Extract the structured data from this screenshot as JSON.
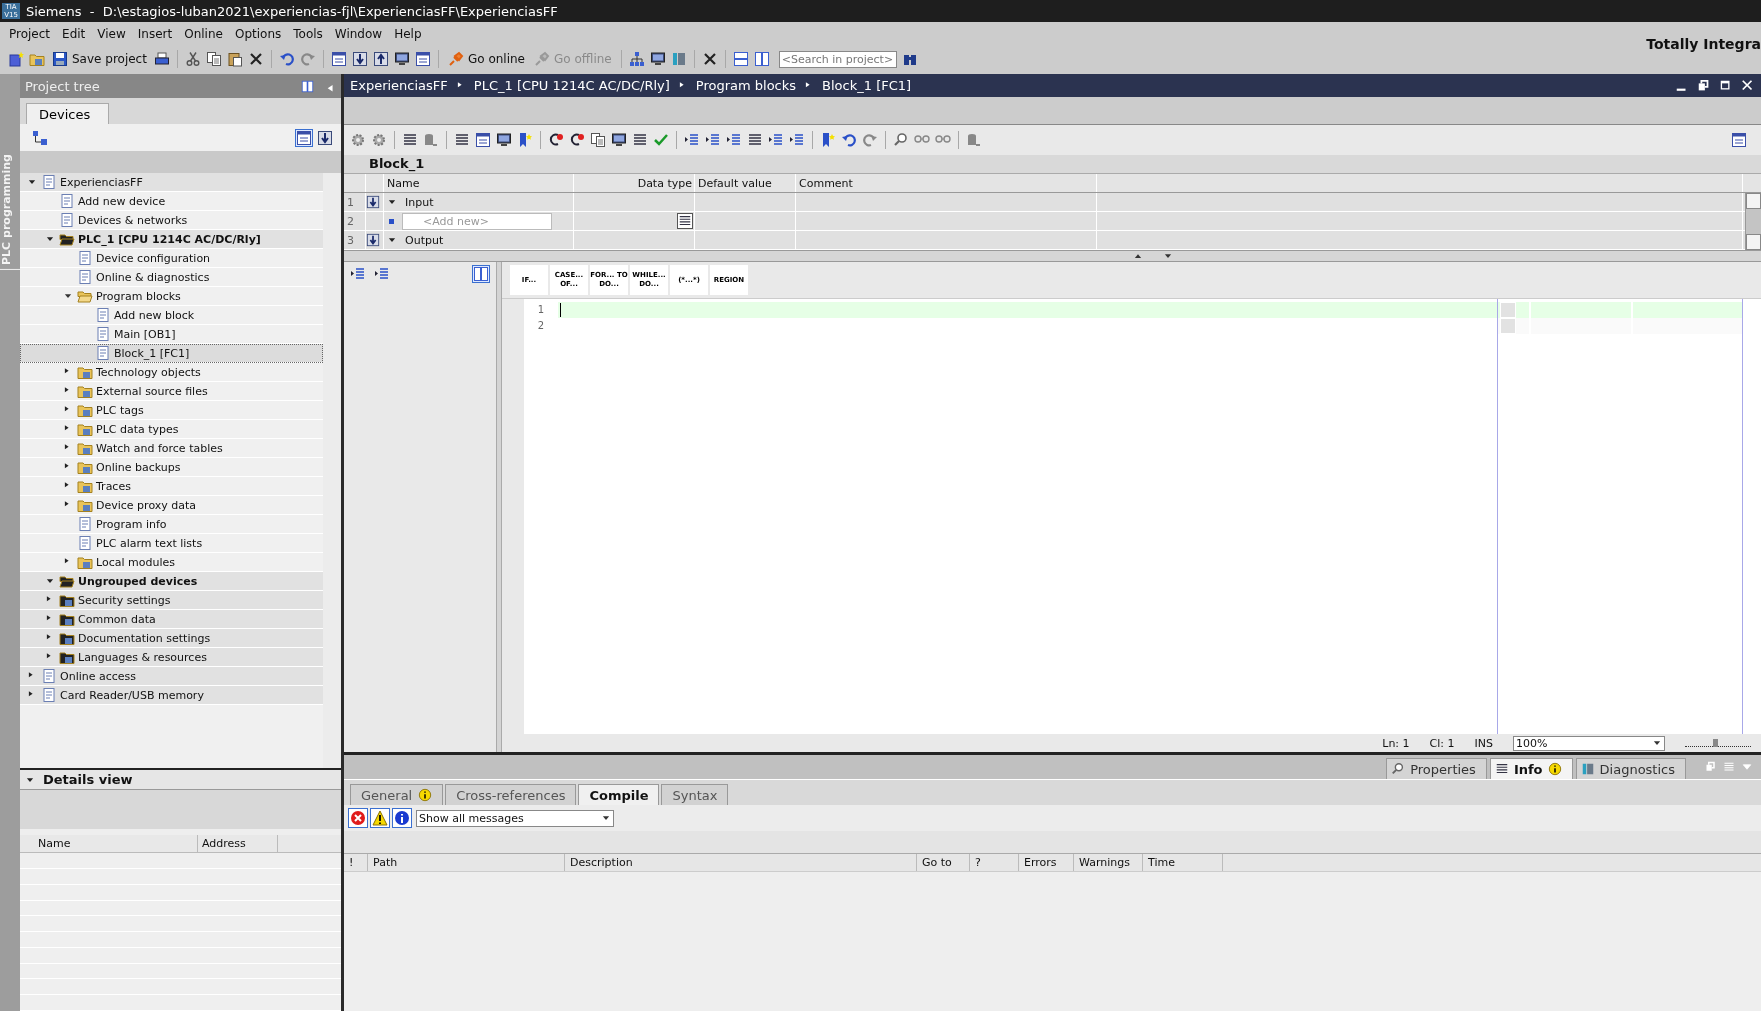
{
  "window": {
    "logo": "TIA V15",
    "title": "Siemens  -  D:\\estagios-luban2021\\experiencias-fjl\\ExperienciasFF\\ExperienciasFF"
  },
  "menu": [
    "Project",
    "Edit",
    "View",
    "Insert",
    "Online",
    "Options",
    "Tools",
    "Window",
    "Help"
  ],
  "toolbar": {
    "save_label": "Save project",
    "online": [
      {
        "label": "Go online",
        "disabled": false
      },
      {
        "label": "Go offline",
        "disabled": true
      }
    ],
    "search": {
      "placeholder": "<Search in project>"
    }
  },
  "product_name": "Totally Integra",
  "side_strip": {
    "label": "PLC programming"
  },
  "project_tree": {
    "title": "Project tree",
    "tabs": [
      {
        "label": "Devices",
        "selected": true
      }
    ],
    "items": [
      {
        "label": "ExperienciasFF",
        "kind": "group",
        "expanded": true,
        "bold": false,
        "selected": false,
        "children": [
          {
            "label": "Add new device",
            "kind": "leaf",
            "bold": false,
            "selected": false
          },
          {
            "label": "Devices & networks",
            "kind": "leaf",
            "bold": false,
            "selected": false
          },
          {
            "label": "PLC_1 [CPU 1214C AC/DC/Rly]",
            "kind": "group",
            "expanded": true,
            "bold": true,
            "selected": false,
            "children": [
              {
                "label": "Device configuration",
                "kind": "leaf",
                "bold": false,
                "selected": false
              },
              {
                "label": "Online & diagnostics",
                "kind": "leaf",
                "bold": false,
                "selected": false
              },
              {
                "label": "Program blocks",
                "kind": "group",
                "expanded": true,
                "bold": false,
                "selected": false,
                "children": [
                  {
                    "label": "Add new block",
                    "kind": "leaf",
                    "bold": false,
                    "selected": false
                  },
                  {
                    "label": "Main [OB1]",
                    "kind": "leaf",
                    "bold": false,
                    "selected": false
                  },
                  {
                    "label": "Block_1 [FC1]",
                    "kind": "leaf",
                    "bold": false,
                    "selected": true
                  }
                ]
              },
              {
                "label": "Technology objects",
                "kind": "group",
                "expanded": false,
                "bold": false,
                "selected": false
              },
              {
                "label": "External source files",
                "kind": "group",
                "expanded": false,
                "bold": false,
                "selected": false
              },
              {
                "label": "PLC tags",
                "kind": "group",
                "expanded": false,
                "bold": false,
                "selected": false
              },
              {
                "label": "PLC data types",
                "kind": "group",
                "expanded": false,
                "bold": false,
                "selected": false
              },
              {
                "label": "Watch and force tables",
                "kind": "group",
                "expanded": false,
                "bold": false,
                "selected": false
              },
              {
                "label": "Online backups",
                "kind": "group",
                "expanded": false,
                "bold": false,
                "selected": false
              },
              {
                "label": "Traces",
                "kind": "group",
                "expanded": false,
                "bold": false,
                "selected": false
              },
              {
                "label": "Device proxy data",
                "kind": "group",
                "expanded": false,
                "bold": false,
                "selected": false
              },
              {
                "label": "Program info",
                "kind": "leaf",
                "bold": false,
                "selected": false
              },
              {
                "label": "PLC alarm text lists",
                "kind": "leaf",
                "bold": false,
                "selected": false
              },
              {
                "label": "Local modules",
                "kind": "group",
                "expanded": false,
                "bold": false,
                "selected": false
              }
            ]
          },
          {
            "label": "Ungrouped devices",
            "kind": "group",
            "expanded": true,
            "bold": true,
            "selected": false
          },
          {
            "label": "Security settings",
            "kind": "group",
            "expanded": false,
            "bold": false,
            "selected": false
          },
          {
            "label": "Common data",
            "kind": "group",
            "expanded": false,
            "bold": false,
            "selected": false
          },
          {
            "label": "Documentation settings",
            "kind": "group",
            "expanded": false,
            "bold": false,
            "selected": false
          },
          {
            "label": "Languages & resources",
            "kind": "group",
            "expanded": false,
            "bold": false,
            "selected": false
          }
        ]
      },
      {
        "label": "Online access",
        "kind": "group",
        "expanded": false,
        "bold": false,
        "selected": false
      },
      {
        "label": "Card Reader/USB memory",
        "kind": "group",
        "expanded": false,
        "bold": false,
        "selected": false
      }
    ]
  },
  "details_view": {
    "title": "Details view",
    "expanded": true,
    "columns": [
      "Name",
      "Address"
    ]
  },
  "editor": {
    "breadcrumb": [
      "ExperienciasFF",
      "PLC_1 [CPU 1214C AC/DC/Rly]",
      "Program blocks",
      "Block_1 [FC1]"
    ],
    "block_title": "Block_1",
    "interface": {
      "columns": [
        "Name",
        "Data type",
        "Default value",
        "Comment"
      ],
      "rows": [
        {
          "number": "1",
          "kind": "section",
          "name": "Input",
          "expanded": true
        },
        {
          "number": "2",
          "kind": "new",
          "placeholder": "<Add new>"
        },
        {
          "number": "3",
          "kind": "section",
          "name": "Output",
          "expanded": true
        }
      ]
    },
    "instructions": [
      "IF...",
      "CASE... OF...",
      "FOR... TO DO...",
      "WHILE... DO...",
      "(*...*)",
      "REGION"
    ],
    "lines": [
      {
        "number": "1",
        "selected": true
      },
      {
        "number": "2",
        "selected": false
      }
    ],
    "status": {
      "line": "Ln: 1",
      "column": "Cl: 1",
      "mode": "INS",
      "zoom": "100%",
      "zoom_slider": {
        "level": 0.45
      }
    }
  },
  "inspector": {
    "tabs": [
      {
        "label": "Properties",
        "selected": false,
        "notice": false
      },
      {
        "label": "Info",
        "selected": true,
        "notice": true
      },
      {
        "label": "Diagnostics",
        "selected": false,
        "notice": false
      }
    ],
    "subtabs": [
      {
        "label": "General",
        "selected": false,
        "notice": true
      },
      {
        "label": "Cross-references",
        "selected": false,
        "notice": false
      },
      {
        "label": "Compile",
        "selected": true,
        "notice": false
      },
      {
        "label": "Syntax",
        "selected": false,
        "notice": false
      }
    ],
    "filters": [
      {
        "kind": "error",
        "on": true
      },
      {
        "kind": "warning",
        "on": true
      },
      {
        "kind": "info",
        "on": true
      }
    ],
    "filter_select": "Show all messages",
    "columns": [
      "!",
      "Path",
      "Description",
      "Go to",
      "?",
      "Errors",
      "Warnings",
      "Time"
    ]
  }
}
